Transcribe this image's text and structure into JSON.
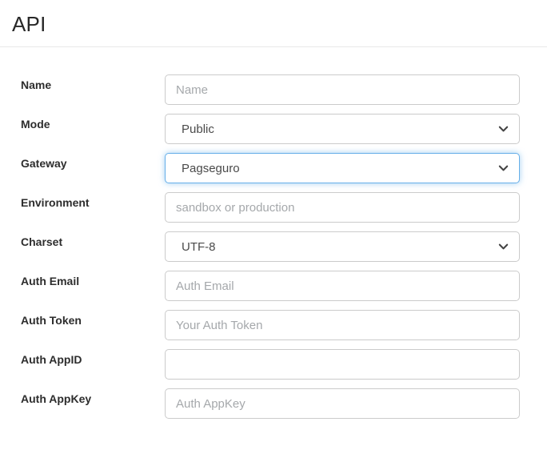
{
  "page": {
    "title": "API"
  },
  "colors": {
    "input_border": "#cbcbcb",
    "focus_border": "#66afe9",
    "label_text": "#2d2d2d",
    "value_text": "#4a4a4a",
    "placeholder_text": "#a5a8ab",
    "divider": "#e8e8e8",
    "chevron": "#444444"
  },
  "icons": {
    "select_chevron": "chevron-down-icon"
  },
  "form": {
    "fields": [
      {
        "label": "Name",
        "type": "text",
        "placeholder": "Name",
        "value": ""
      },
      {
        "label": "Mode",
        "type": "select",
        "value": "Public",
        "focused": false
      },
      {
        "label": "Gateway",
        "type": "select",
        "value": "Pagseguro",
        "focused": true
      },
      {
        "label": "Environment",
        "type": "text",
        "placeholder": "sandbox or production",
        "value": ""
      },
      {
        "label": "Charset",
        "type": "select",
        "value": "UTF-8",
        "focused": false
      },
      {
        "label": "Auth Email",
        "type": "text",
        "placeholder": "Auth Email",
        "value": ""
      },
      {
        "label": "Auth Token",
        "type": "text",
        "placeholder": "Your Auth Token",
        "value": ""
      },
      {
        "label": "Auth AppID",
        "type": "text",
        "placeholder": "",
        "value": ""
      },
      {
        "label": "Auth AppKey",
        "type": "text",
        "placeholder": "Auth AppKey",
        "value": ""
      }
    ]
  }
}
